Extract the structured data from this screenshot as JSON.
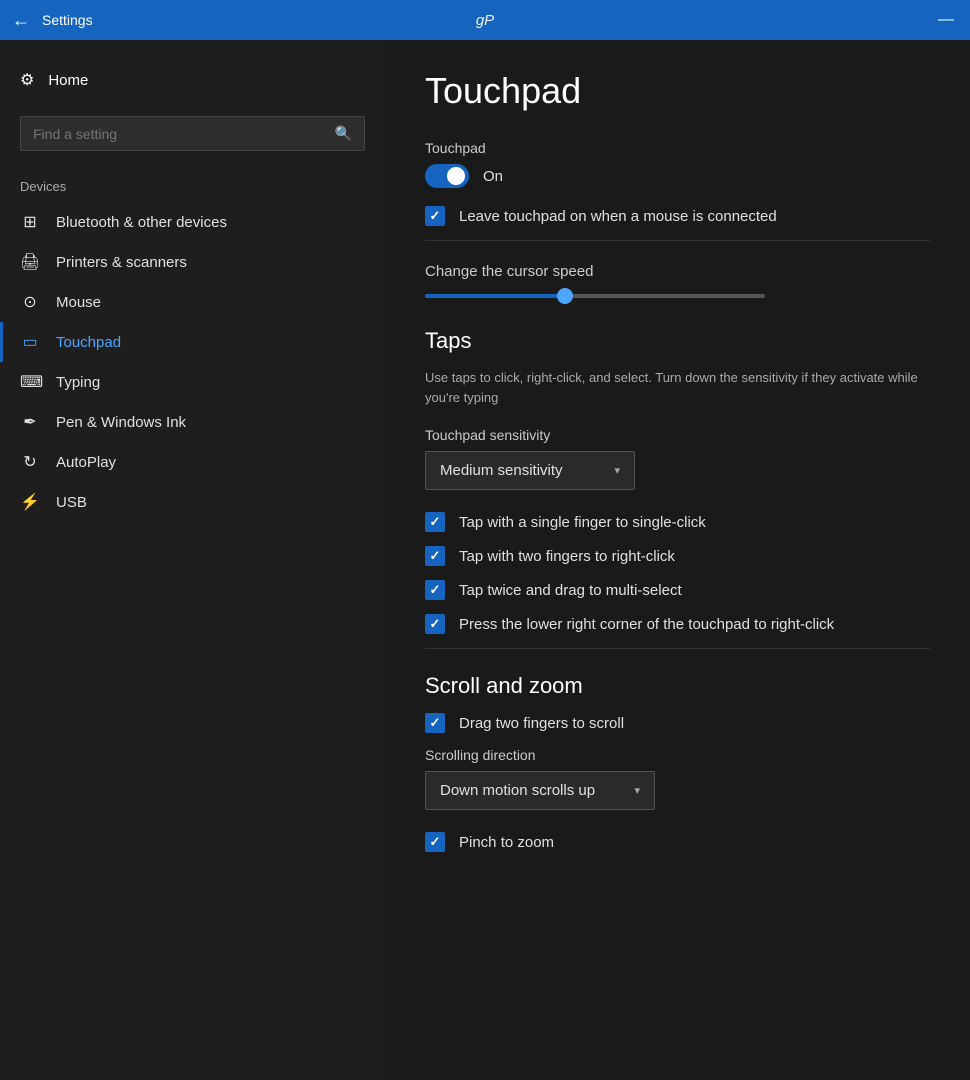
{
  "titlebar": {
    "back_label": "←",
    "title": "Settings",
    "brand": "gP",
    "minimize": "—"
  },
  "sidebar": {
    "home_label": "Home",
    "search_placeholder": "Find a setting",
    "devices_label": "Devices",
    "nav_items": [
      {
        "id": "bluetooth",
        "label": "Bluetooth & other devices",
        "icon": "⊞"
      },
      {
        "id": "printers",
        "label": "Printers & scanners",
        "icon": "🖨"
      },
      {
        "id": "mouse",
        "label": "Mouse",
        "icon": "🖱"
      },
      {
        "id": "touchpad",
        "label": "Touchpad",
        "icon": "▭",
        "active": true
      },
      {
        "id": "typing",
        "label": "Typing",
        "icon": "⌨"
      },
      {
        "id": "pen",
        "label": "Pen & Windows Ink",
        "icon": "✒"
      },
      {
        "id": "autoplay",
        "label": "AutoPlay",
        "icon": "⟳"
      },
      {
        "id": "usb",
        "label": "USB",
        "icon": "⚡"
      }
    ]
  },
  "content": {
    "page_title": "Touchpad",
    "touchpad_section_label": "Touchpad",
    "toggle_on": "On",
    "leave_touchpad_label": "Leave touchpad on when a mouse is connected",
    "cursor_speed_label": "Change the cursor speed",
    "taps_heading": "Taps",
    "taps_description": "Use taps to click, right-click, and select. Turn down the sensitivity if they activate while you're typing",
    "sensitivity_label": "Touchpad sensitivity",
    "sensitivity_value": "Medium sensitivity",
    "checkboxes": [
      {
        "id": "single-finger",
        "label": "Tap with a single finger to single-click",
        "checked": true
      },
      {
        "id": "two-finger",
        "label": "Tap with two fingers to right-click",
        "checked": true
      },
      {
        "id": "twice-drag",
        "label": "Tap twice and drag to multi-select",
        "checked": true
      },
      {
        "id": "lower-right",
        "label": "Press the lower right corner of the touchpad to right-click",
        "checked": true
      }
    ],
    "scroll_zoom_heading": "Scroll and zoom",
    "drag_two_fingers_label": "Drag two fingers to scroll",
    "scrolling_direction_label": "Scrolling direction",
    "scrolling_direction_value": "Down motion scrolls up",
    "pinch_zoom_label": "Pinch to zoom"
  }
}
